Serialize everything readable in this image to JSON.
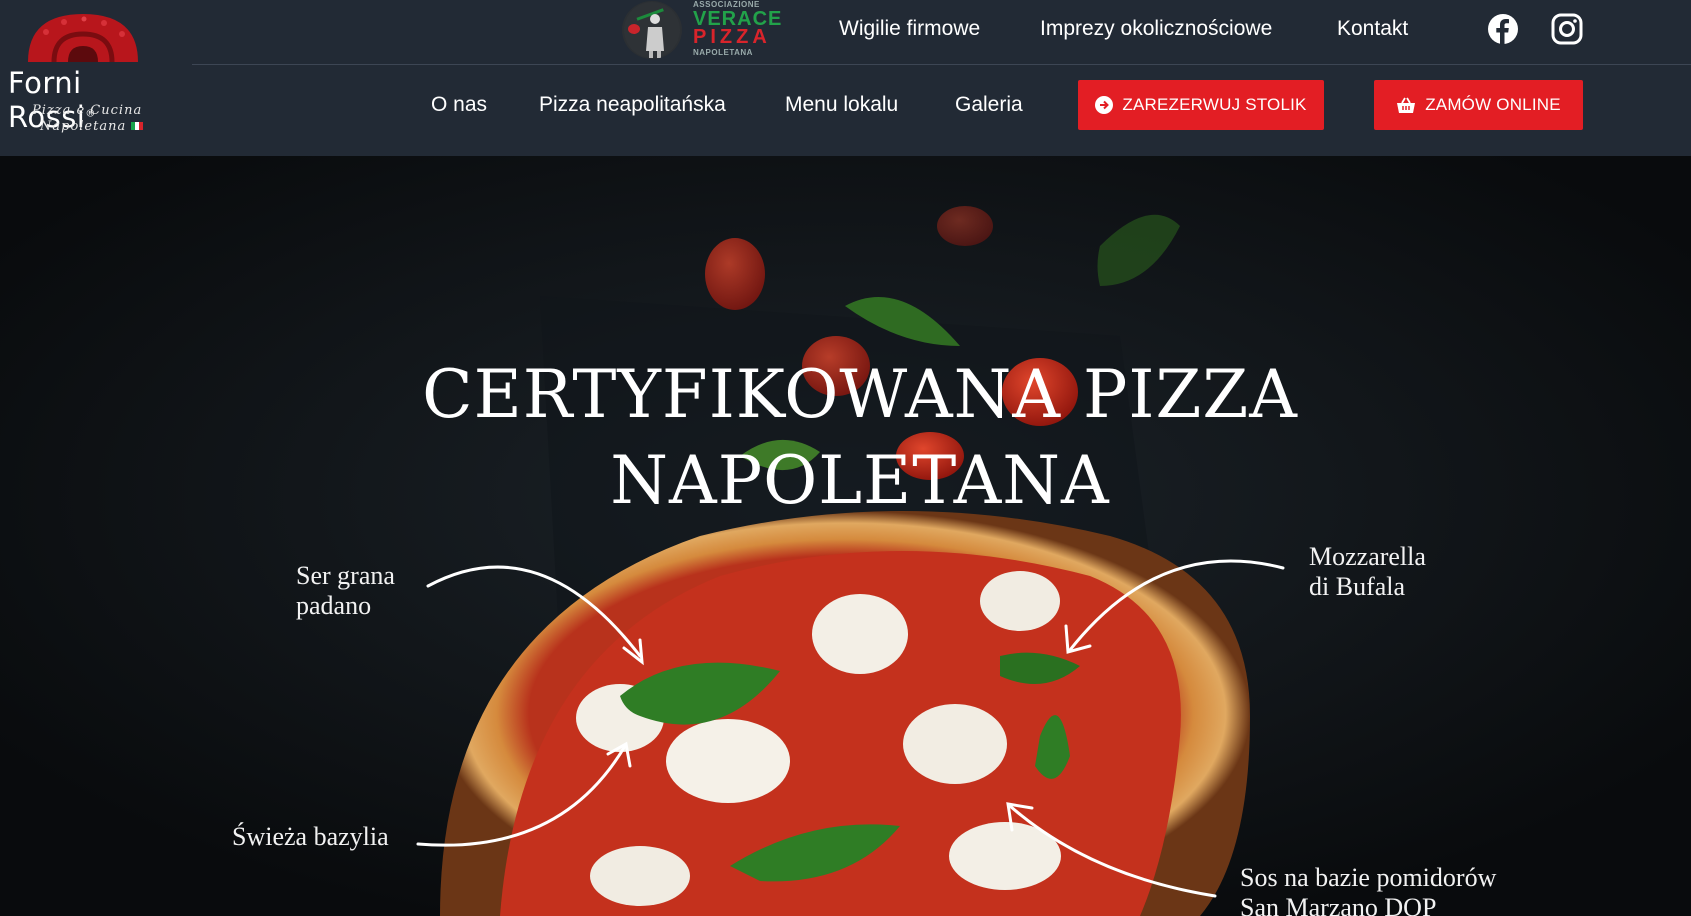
{
  "brand": {
    "name": "Forni Rossi",
    "registered": "®",
    "tagline_line1": "Pizza e Cucina",
    "tagline_line2": "Napoletana",
    "primary_color": "#e31e24",
    "header_color": "#222a35"
  },
  "certification": {
    "line1": "ASSOCIAZIONE",
    "line2": "VERACE",
    "line3": "PIZZA",
    "line4": "NAPOLETANA"
  },
  "top_nav": [
    {
      "label": "Wigilie firmowe"
    },
    {
      "label": "Imprezy okolicznościowe"
    },
    {
      "label": "Kontakt"
    }
  ],
  "social": [
    {
      "icon": "facebook-icon"
    },
    {
      "icon": "instagram-icon"
    }
  ],
  "main_nav": [
    {
      "label": "O nas"
    },
    {
      "label": "Pizza neapolitańska"
    },
    {
      "label": "Menu lokalu"
    },
    {
      "label": "Galeria"
    }
  ],
  "buttons": {
    "reserve": {
      "label": "ZAREZERWUJ STOLIK",
      "icon": "arrow-circle-icon"
    },
    "order": {
      "label": "ZAMÓW ONLINE",
      "icon": "basket-icon"
    }
  },
  "hero": {
    "title_line1": "CERTYFIKOWANA PIZZA",
    "title_line2": "NAPOLETANA",
    "labels": {
      "grana_line1": "Ser grana",
      "grana_line2": "padano",
      "mozzarella_line1": "Mozzarella",
      "mozzarella_line2": "di Bufala",
      "basil": "Świeża bazylia",
      "sauce_line1": "Sos na bazie pomidorów",
      "sauce_line2": "San Marzano DOP"
    }
  }
}
